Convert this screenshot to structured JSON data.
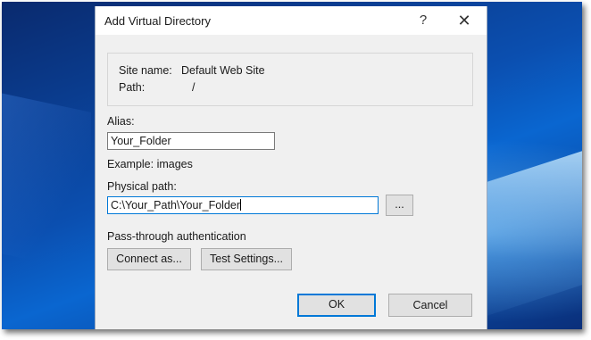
{
  "dialog": {
    "title": "Add Virtual Directory",
    "help_symbol": "?",
    "close_symbol": "✕"
  },
  "info": {
    "site_name_label": "Site name:",
    "site_name_value": "Default Web Site",
    "path_label": "Path:",
    "path_value": "/"
  },
  "alias": {
    "label": "Alias:",
    "value": "Your_Folder",
    "example": "Example: images"
  },
  "physical_path": {
    "label": "Physical path:",
    "value": "C:\\Your_Path\\Your_Folder",
    "browse_label": "..."
  },
  "pass_through": {
    "label": "Pass-through authentication",
    "connect_as_label": "Connect as...",
    "test_settings_label": "Test Settings..."
  },
  "footer": {
    "ok_label": "OK",
    "cancel_label": "Cancel"
  },
  "colors": {
    "accent": "#0078d7",
    "dialog_bg": "#f0f0f0"
  }
}
